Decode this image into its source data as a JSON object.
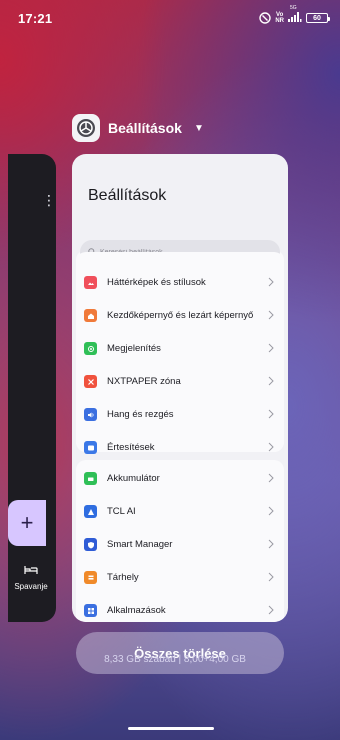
{
  "status_bar": {
    "time": "17:21",
    "volte_top": "Vo",
    "volte_bottom": "NR",
    "network": "5G",
    "battery": "60"
  },
  "left_app": {
    "label": "Spavanje"
  },
  "app_header": {
    "name": "Beállítások"
  },
  "card": {
    "title": "Beállítások",
    "search_placeholder": "Keresési beállítások",
    "group1": [
      {
        "label": "Háttérképek és stílusok",
        "icon": "wallpaper-icon",
        "color": "#f04f5b"
      },
      {
        "label": "Kezdőképernyő és lezárt képernyő",
        "icon": "lock-screen-icon",
        "color": "#f07a3a"
      },
      {
        "label": "Megjelenítés",
        "icon": "display-icon",
        "color": "#2fbf57"
      },
      {
        "label": "NXTPAPER zóna",
        "icon": "nxtpaper-icon",
        "color": "#f0523e"
      },
      {
        "label": "Hang és rezgés",
        "icon": "sound-icon",
        "color": "#3b6fe0"
      },
      {
        "label": "Értesítések",
        "icon": "notifications-icon",
        "color": "#3b78e7"
      }
    ],
    "group2": [
      {
        "label": "Akkumulátor",
        "icon": "battery-icon",
        "color": "#2fbf57"
      },
      {
        "label": "TCL AI",
        "icon": "ai-icon",
        "color": "#2f6de0"
      },
      {
        "label": "Smart Manager",
        "icon": "shield-icon",
        "color": "#2f5cd6"
      },
      {
        "label": "Tárhely",
        "icon": "storage-icon",
        "color": "#f08a2a"
      },
      {
        "label": "Alkalmazások",
        "icon": "apps-icon",
        "color": "#3b6fe0"
      }
    ]
  },
  "clear_all_label": "Összes törlése",
  "memory_info": "8,33 GB szabad | 8,00+4,00 GB"
}
